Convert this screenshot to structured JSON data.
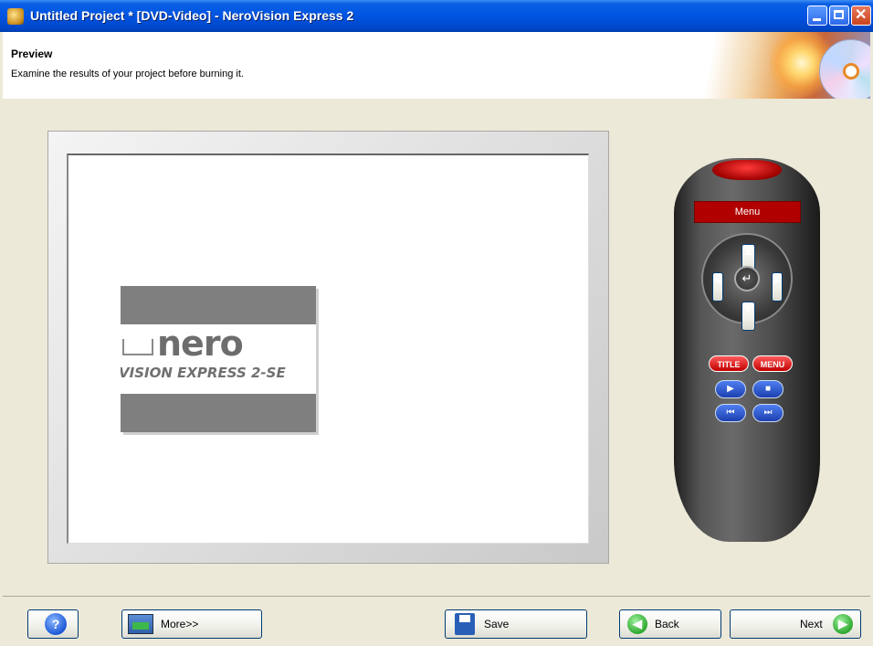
{
  "window": {
    "title": "Untitled Project * [DVD-Video] - NeroVision Express 2",
    "app_icon": "nerovision-icon",
    "controls": {
      "minimize": "minimize-icon",
      "maximize": "maximize-icon",
      "close": "close-icon"
    }
  },
  "header": {
    "title": "Preview",
    "subtitle": "Examine the results of your project before burning it."
  },
  "preview": {
    "logo_brand": "nero",
    "logo_tagline": "VISION EXPRESS 2-SE"
  },
  "remote": {
    "display_label": "Menu",
    "title_button": "TITLE",
    "menu_button": "MENU",
    "dpad": {
      "up": "▲",
      "down": "▼",
      "left": "◀",
      "right": "▶",
      "ok": "↵"
    },
    "transport": {
      "play": "▶",
      "stop": "■",
      "prev": "⏮",
      "next": "⏭"
    }
  },
  "buttons": {
    "help": "?",
    "more": "More>>",
    "save": "Save",
    "back": "Back",
    "next": "Next"
  },
  "colors": {
    "titlebar": "#0054e3",
    "window_bg": "#ece9d8",
    "remote_accent": "#b00000"
  }
}
